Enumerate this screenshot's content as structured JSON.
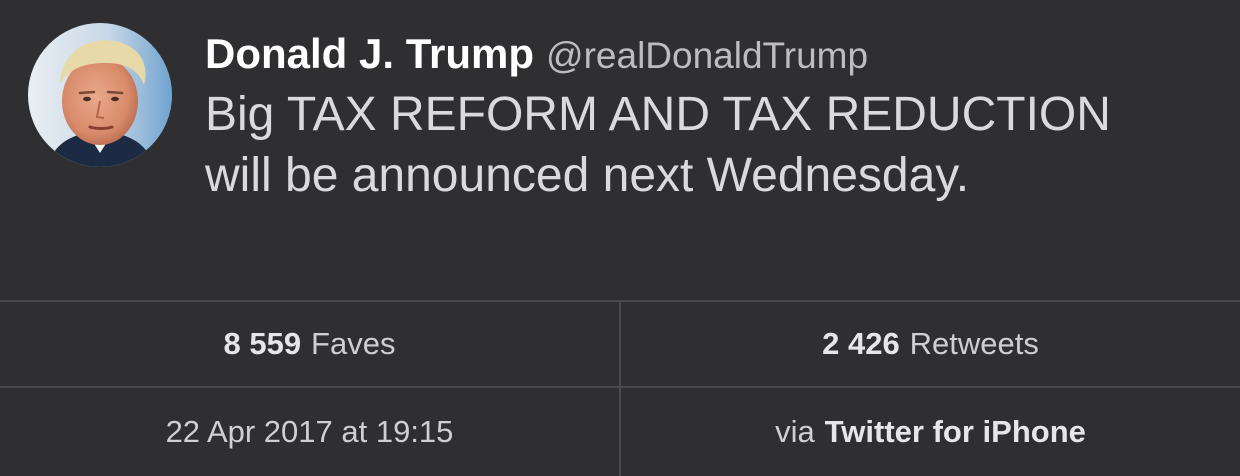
{
  "tweet": {
    "author_name": "Donald J. Trump",
    "author_handle": "@realDonaldTrump",
    "text": "Big TAX REFORM AND TAX REDUCTION will be announced next Wednesday.",
    "avatar_icon": "profile-photo"
  },
  "stats": {
    "faves_count": "8 559",
    "faves_label": "Faves",
    "retweets_count": "2 426",
    "retweets_label": "Retweets"
  },
  "meta": {
    "timestamp": "22 Apr 2017 at 19:15",
    "via_label": "via",
    "source": "Twitter for iPhone"
  },
  "colors": {
    "background": "#2f2f31",
    "name": "#ffffff",
    "handle": "#bdbdbf",
    "text": "#dadadc",
    "divider": "#4a4a4c"
  }
}
